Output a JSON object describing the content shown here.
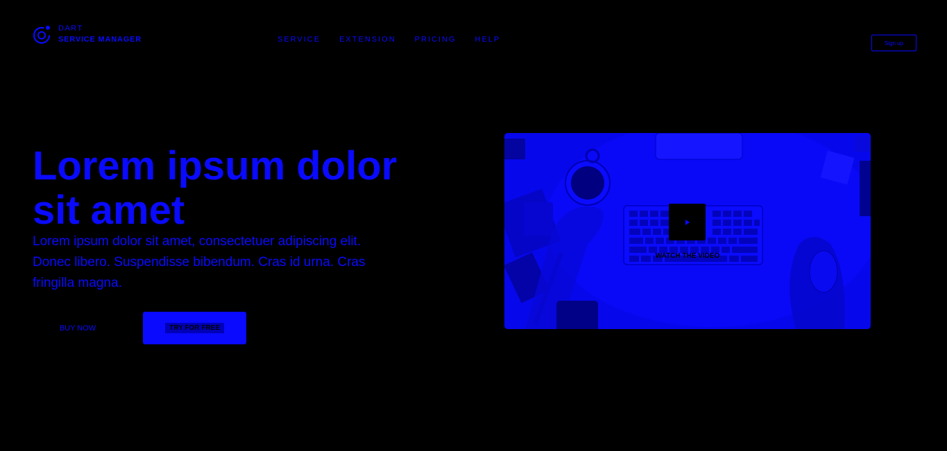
{
  "header": {
    "logo": {
      "line1": "DART",
      "line2": "SERVICE MANAGER",
      "icon": "target-refresh-icon"
    },
    "nav": [
      {
        "label": "SERVICE"
      },
      {
        "label": "EXTENSION"
      },
      {
        "label": "PRICING"
      },
      {
        "label": "HELP"
      }
    ],
    "signup_label": "Sign up"
  },
  "hero": {
    "title": "Lorem ipsum dolor sit amet",
    "description": "Lorem ipsum dolor sit amet, consectetuer adipiscing elit. Donec libero. Suspendisse bibendum. Cras id urna. Cras fringilla magna.",
    "buy_label": "BUY NOW",
    "try_label": "TRY FOR FREE"
  },
  "video": {
    "watch_label": "WATCH THE VIDEO",
    "play_icon": "play-icon"
  },
  "colors": {
    "background": "#000000",
    "accent": "#0a0aff"
  }
}
